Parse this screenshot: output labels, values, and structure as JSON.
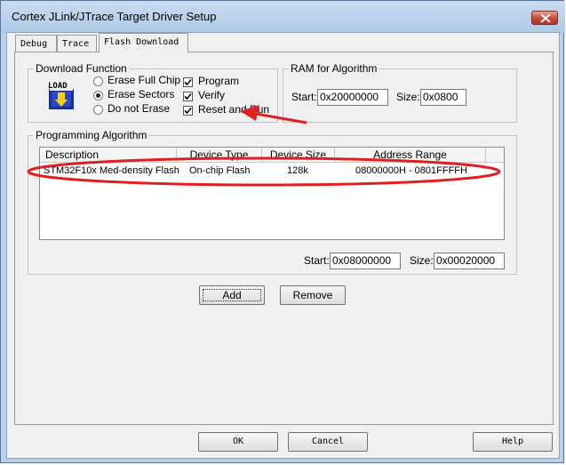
{
  "window": {
    "title": "Cortex JLink/JTrace Target Driver Setup"
  },
  "tabs": [
    {
      "label": "Debug"
    },
    {
      "label": "Trace"
    },
    {
      "label": "Flash Download"
    }
  ],
  "download_function": {
    "title": "Download Function",
    "icon_text": "LOAD",
    "erase_options": [
      {
        "label": "Erase Full Chip",
        "checked": false
      },
      {
        "label": "Erase Sectors",
        "checked": true
      },
      {
        "label": "Do not Erase",
        "checked": false
      }
    ],
    "checkboxes": [
      {
        "label": "Program",
        "checked": true
      },
      {
        "label": "Verify",
        "checked": true
      },
      {
        "label": "Reset and Run",
        "checked": true
      }
    ]
  },
  "ram": {
    "title": "RAM for Algorithm",
    "start_label": "Start:",
    "start_value": "0x20000000",
    "size_label": "Size:",
    "size_value": "0x0800"
  },
  "programming": {
    "title": "Programming Algorithm",
    "columns": [
      "Description",
      "Device Type",
      "Device Size",
      "Address Range"
    ],
    "rows": [
      [
        "STM32F10x Med-density Flash",
        "On-chip Flash",
        "128k",
        "08000000H - 0801FFFFH"
      ]
    ],
    "start_label": "Start:",
    "start_value": "0x08000000",
    "size_label": "Size:",
    "size_value": "0x00020000"
  },
  "buttons": {
    "add": "Add",
    "remove": "Remove",
    "ok": "OK",
    "cancel": "Cancel",
    "help": "Help"
  },
  "colors": {
    "annotation": "#e02020",
    "titlebar": "#b9d1ea",
    "close": "#c7473a"
  }
}
